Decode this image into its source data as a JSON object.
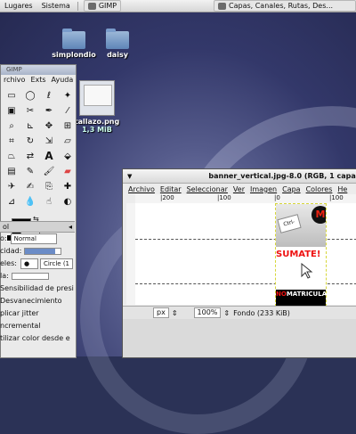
{
  "top_panel": {
    "menus": [
      "Lugares",
      "Sistema"
    ],
    "tasks": [
      {
        "label": "GIMP"
      },
      {
        "label": "Capas, Canales, Rutas, Des..."
      }
    ]
  },
  "desktop": {
    "icons": [
      {
        "label": "simplondio"
      },
      {
        "label": "daisy"
      },
      {
        "label": "tallazo.png",
        "sublabel": "1,3 MiB"
      }
    ]
  },
  "toolbox": {
    "title": "GIMP",
    "menu": [
      "rchivo",
      "Exts",
      "Ayuda"
    ],
    "tool_icons": [
      "select-rect",
      "select-ellipse",
      "lasso",
      "fuzzy-select",
      "by-color",
      "scissors",
      "paths",
      "color-picker",
      "zoom",
      "measure",
      "move",
      "align",
      "crop",
      "rotate",
      "scale",
      "shear",
      "perspective",
      "flip",
      "text",
      "bucket",
      "blend",
      "pencil",
      "paintbrush",
      "eraser",
      "airbrush",
      "ink",
      "clone",
      "heal",
      "perspective-clone",
      "blur",
      "smudge",
      "dodge"
    ],
    "colors": {
      "foreground": "#000000",
      "background": "#ffffff"
    }
  },
  "tool_options": {
    "header": "ol",
    "mode_label": "o:",
    "mode_value": "Normal",
    "opacity_label": "cidad:",
    "opacity_level": 0.85,
    "brush_label": "eles:",
    "brush_value": "Circle (1",
    "scale_label": "la:",
    "checks": [
      "Sensibilidad de presi",
      "Desvanecimiento",
      "plicar jitter",
      "ncremental",
      "tilizar color desde e"
    ]
  },
  "image_window": {
    "title": "banner_vertical.jpg-8.0 (RGB, 1 capa) 88x",
    "menu": [
      "Archivo",
      "Editar",
      "Seleccionar",
      "Ver",
      "Imagen",
      "Capa",
      "Colores",
      "He"
    ],
    "ruler_labels": [
      "|200",
      "|100",
      "|0",
      "|100"
    ],
    "banner_text": {
      "key": "Ctrl-",
      "circle": "M",
      "sumate": "SUMATE!",
      "bottom_prefix": "NO",
      "bottom_rest": "MATRICULA"
    },
    "status": {
      "unit": "px",
      "zoom": "100%",
      "info": "Fondo (233 KiB)"
    }
  }
}
